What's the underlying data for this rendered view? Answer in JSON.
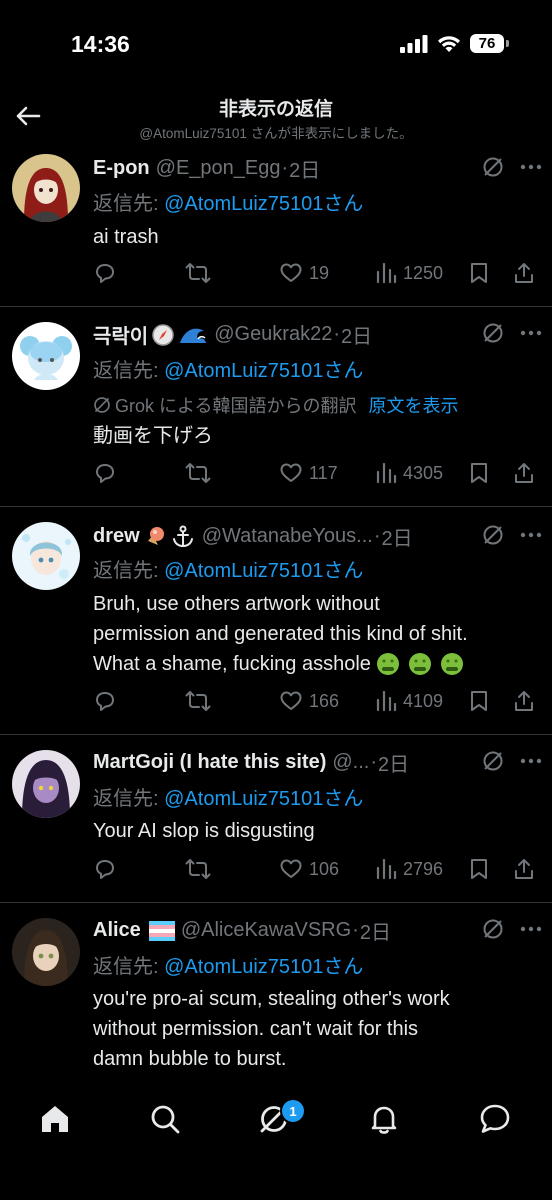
{
  "status": {
    "time": "14:36",
    "battery": "76"
  },
  "header": {
    "title": "非表示の返信",
    "subtitle": "@AtomLuiz75101 さんが非表示にしました。"
  },
  "posts": [
    {
      "name": "E-pon",
      "handle": "@E_pon_Egg",
      "dot": "·",
      "age": "2日",
      "reply_prefix": "返信先: ",
      "reply_to": "@AtomLuiz75101さん",
      "text": "ai trash",
      "likes": "19",
      "views": "1250"
    },
    {
      "name": "극락이",
      "handle": "@Geukrak22",
      "dot": "·",
      "age": "2日",
      "reply_prefix": "返信先: ",
      "reply_to": "@AtomLuiz75101さん",
      "translation_note": "Grok による韓国語からの翻訳",
      "translation_link": "原文を表示",
      "text": "動画を下げろ",
      "likes": "117",
      "views": "4305"
    },
    {
      "name": "drew",
      "handle": "@WatanabeYous...",
      "dot": "·",
      "age": "2日",
      "reply_prefix": "返信先: ",
      "reply_to": "@AtomLuiz75101さん",
      "text_lines": [
        "Bruh, use others artwork without",
        "permission and generated this kind of shit.",
        "What a shame, fucking asshole"
      ],
      "likes": "166",
      "views": "4109"
    },
    {
      "name": "MartGoji (I hate this site)",
      "handle": "@...",
      "dot": "·",
      "age": "2日",
      "reply_prefix": "返信先: ",
      "reply_to": "@AtomLuiz75101さん",
      "text": "Your AI slop is disgusting",
      "likes": "106",
      "views": "2796"
    },
    {
      "name": "Alice",
      "handle": "@AliceKawaVSRG",
      "dot": "·",
      "age": "2日",
      "reply_prefix": "返信先: ",
      "reply_to": "@AtomLuiz75101さん",
      "text_lines": [
        "you're pro-ai scum, stealing other's work",
        "without permission. can't wait for this",
        "damn bubble to burst."
      ]
    }
  ],
  "tabbar": {
    "notification_badge": "1"
  },
  "icons": [
    "back-arrow-icon",
    "reply-icon",
    "repost-icon",
    "like-icon",
    "views-icon",
    "bookmark-icon",
    "share-icon",
    "grok-icon",
    "more-icon",
    "home-icon",
    "search-icon",
    "grok-tab-icon",
    "bell-icon",
    "messages-icon"
  ],
  "colors": {
    "background": "#000000",
    "text": "#e7e9ea",
    "muted": "#71767b",
    "accent": "#1d9bf0",
    "divider": "#2f3336"
  }
}
